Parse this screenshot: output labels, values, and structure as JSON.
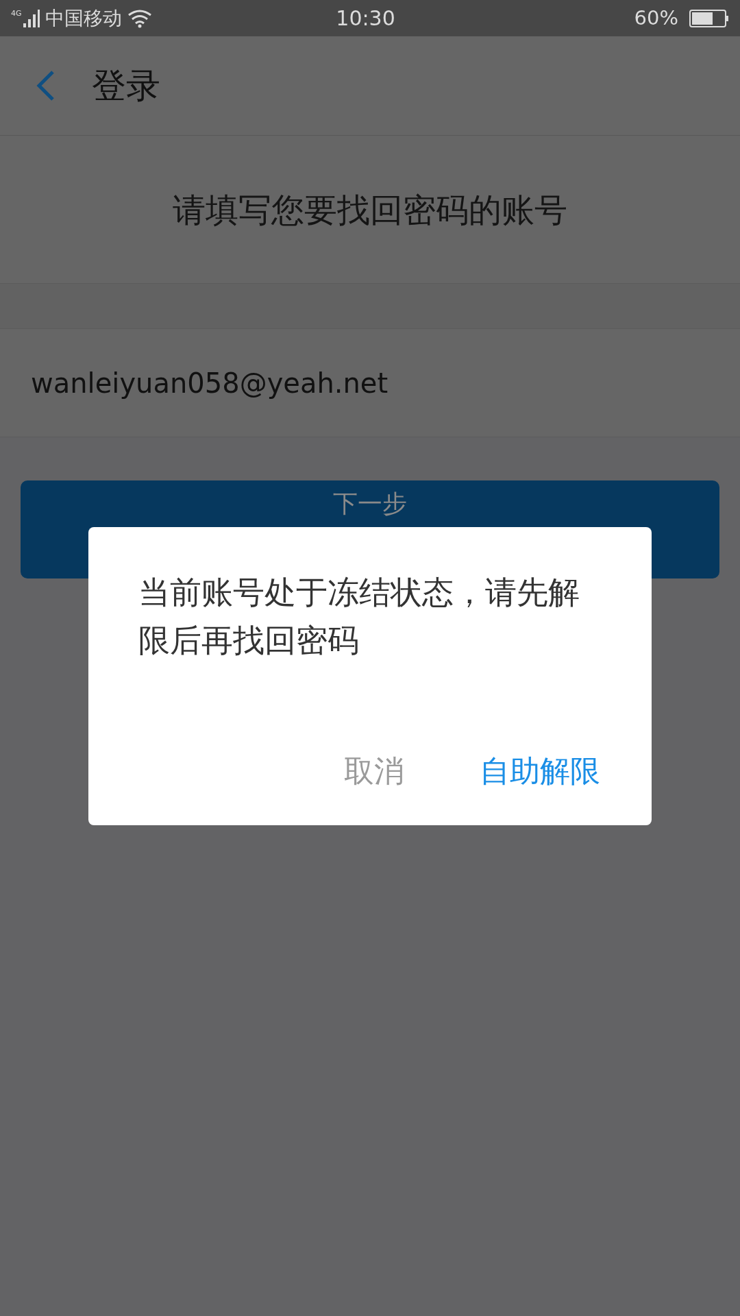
{
  "status_bar": {
    "network": "4G",
    "carrier": "中国移动",
    "time": "10:30",
    "battery": "60%"
  },
  "header": {
    "title": "登录"
  },
  "prompt": "请填写您要找回密码的账号",
  "account_field": {
    "value": "wanleiyuan058@yeah.net"
  },
  "next_button": {
    "label": "下一步"
  },
  "dialog": {
    "message": "当前账号处于冻结状态，请先解限后再找回密码",
    "buttons": [
      {
        "label": "取消",
        "kind": "secondary"
      },
      {
        "label": "自助解限",
        "kind": "primary"
      }
    ]
  }
}
